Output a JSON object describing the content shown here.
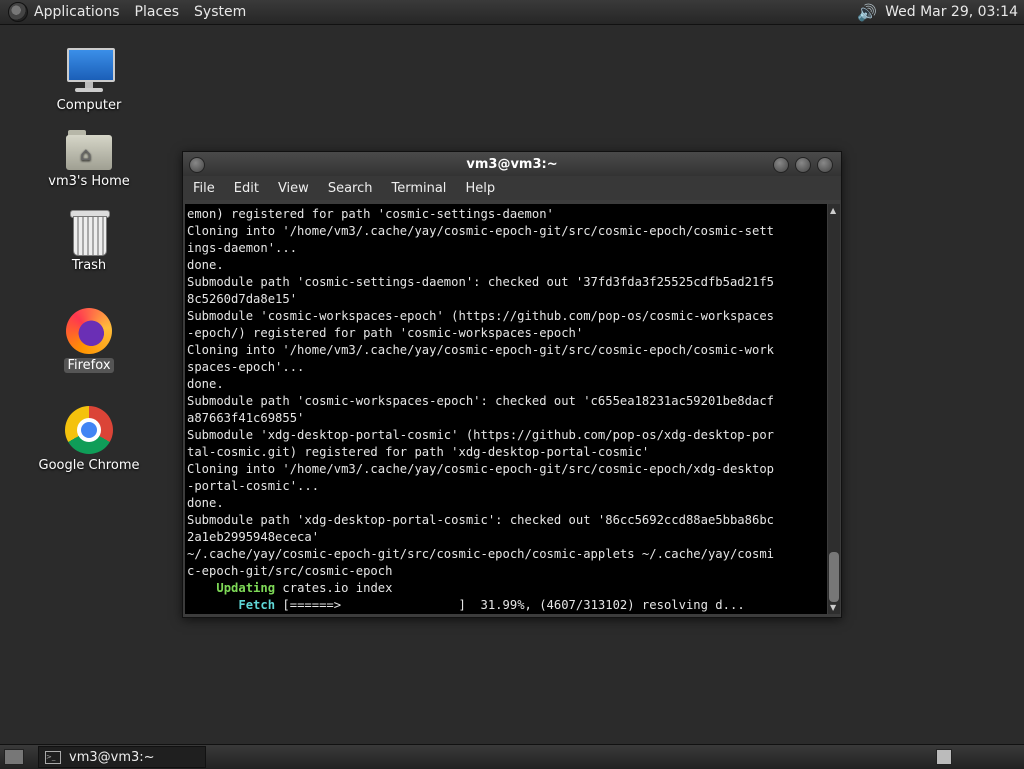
{
  "top_panel": {
    "menus": [
      "Applications",
      "Places",
      "System"
    ],
    "clock": "Wed Mar 29, 03:14",
    "volume_icon": "volume-icon"
  },
  "desktop": {
    "icons": [
      {
        "label": "Computer",
        "icon": "computer-icon"
      },
      {
        "label": "vm3's Home",
        "icon": "home-folder-icon"
      },
      {
        "label": "Trash",
        "icon": "trash-icon"
      },
      {
        "label": "Firefox",
        "icon": "firefox-icon"
      },
      {
        "label": "Google Chrome",
        "icon": "chrome-icon"
      }
    ]
  },
  "terminal": {
    "title": "vm3@vm3:~",
    "menu": [
      "File",
      "Edit",
      "View",
      "Search",
      "Terminal",
      "Help"
    ],
    "lines": [
      "emon) registered for path 'cosmic-settings-daemon'",
      "Cloning into '/home/vm3/.cache/yay/cosmic-epoch-git/src/cosmic-epoch/cosmic-sett",
      "ings-daemon'...",
      "done.",
      "Submodule path 'cosmic-settings-daemon': checked out '37fd3fda3f25525cdfb5ad21f5",
      "8c5260d7da8e15'",
      "Submodule 'cosmic-workspaces-epoch' (https://github.com/pop-os/cosmic-workspaces",
      "-epoch/) registered for path 'cosmic-workspaces-epoch'",
      "Cloning into '/home/vm3/.cache/yay/cosmic-epoch-git/src/cosmic-epoch/cosmic-work",
      "spaces-epoch'...",
      "done.",
      "Submodule path 'cosmic-workspaces-epoch': checked out 'c655ea18231ac59201be8dacf",
      "a87663f41c69855'",
      "Submodule 'xdg-desktop-portal-cosmic' (https://github.com/pop-os/xdg-desktop-por",
      "tal-cosmic.git) registered for path 'xdg-desktop-portal-cosmic'",
      "Cloning into '/home/vm3/.cache/yay/cosmic-epoch-git/src/cosmic-epoch/xdg-desktop",
      "-portal-cosmic'...",
      "done.",
      "Submodule path 'xdg-desktop-portal-cosmic': checked out '86cc5692ccd88ae5bba86bc",
      "2a1eb2995948ececa'",
      "~/.cache/yay/cosmic-epoch-git/src/cosmic-epoch/cosmic-applets ~/.cache/yay/cosmi",
      "c-epoch-git/src/cosmic-epoch"
    ],
    "updating_label": "Updating",
    "updating_text": " crates.io index",
    "fetch_label": "Fetch",
    "fetch_text": " [======>                ]  31.99%, (4607/313102) resolving d..."
  },
  "bottom_panel": {
    "task_label": "vm3@vm3:~"
  }
}
